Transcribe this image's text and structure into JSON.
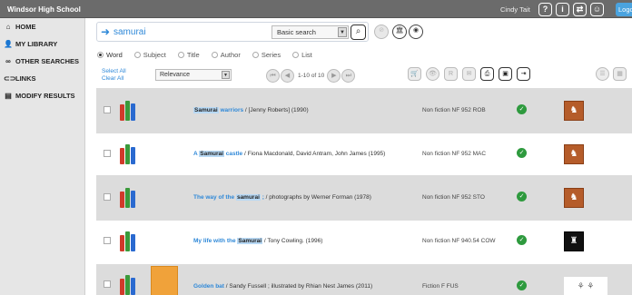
{
  "topbar": {
    "school": "Windsor High School",
    "user": "Cindy Tait",
    "logout": "Logout",
    "icons": [
      "help-icon",
      "info-icon",
      "switch-icon",
      "account-icon"
    ]
  },
  "sidebar": {
    "items": [
      {
        "label": "HOME",
        "icon": "home-icon"
      },
      {
        "label": "MY LIBRARY",
        "icon": "person-icon"
      },
      {
        "label": "OTHER SEARCHES",
        "icon": "binoculars-icon"
      },
      {
        "label": "LINKS",
        "icon": "link-icon"
      },
      {
        "label": "MODIFY RESULTS",
        "icon": "document-icon"
      }
    ]
  },
  "search": {
    "query": "samurai",
    "mode": "Basic search"
  },
  "radios": [
    "Word",
    "Subject",
    "Title",
    "Author",
    "Series",
    "List"
  ],
  "toolbar": {
    "select_all": "Select All",
    "clear_all": "Clear All",
    "sort": "Relevance",
    "page_info": "1-10 of 10"
  },
  "results": [
    {
      "title_hl": "Samurai",
      "title_rest": " warriors",
      "resp": " / [Jenny Roberts] (1990)",
      "call": "Non fiction NF 952 ROB"
    },
    {
      "title_pre": "A ",
      "title_hl": "Samurai",
      "title_rest": " castle",
      "resp": " / Fiona Macdonald, David Antram, John James (1995)",
      "call": "Non fiction NF 952 MAC"
    },
    {
      "title_pre": "The way of the ",
      "title_hl": "samurai",
      "title_rest": " ;",
      "resp": " / photographs by Werner Forman (1978)",
      "call": "Non fiction NF 952 STO"
    },
    {
      "title_pre": "My life with the ",
      "title_hl": "Samurai",
      "title_rest": "",
      "resp": " / Tony Cowling. (1996)",
      "call": "Non fiction NF 940.54 COW"
    },
    {
      "title_rest": "Golden bat",
      "resp": " / Sandy Fussell ; illustrated by Rhian Nest James (2011)",
      "call": "Fiction F FUS"
    }
  ]
}
